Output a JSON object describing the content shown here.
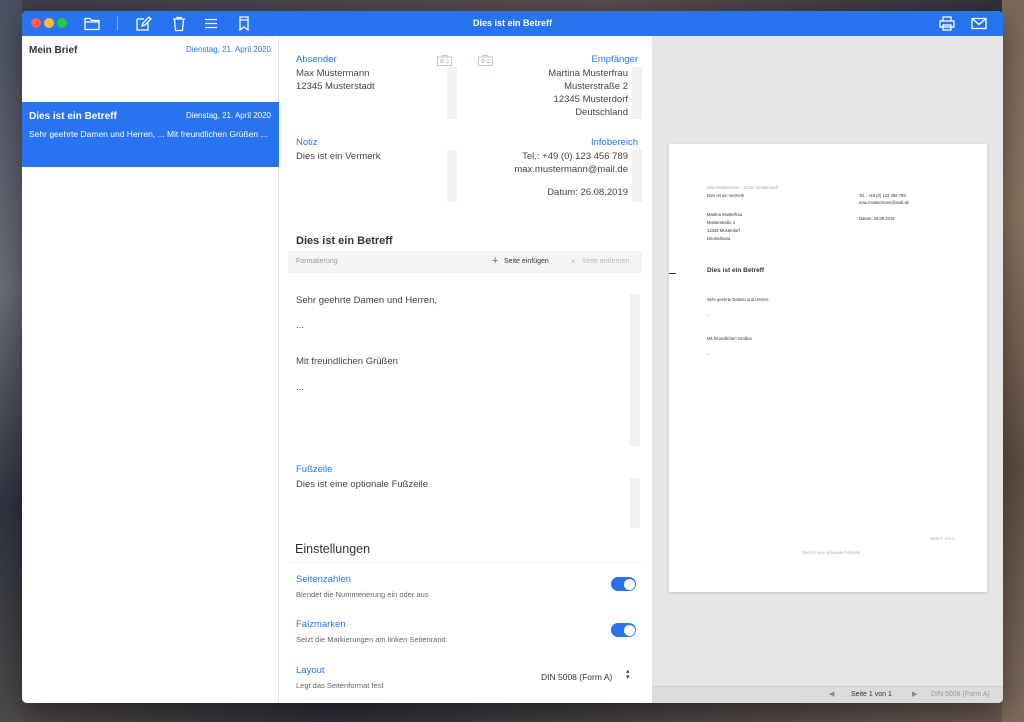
{
  "window": {
    "title": "Dies ist ein Betreff"
  },
  "toolbar": {
    "icons": [
      "folder-icon",
      "compose-icon",
      "trash-icon",
      "list-icon",
      "bookmark-icon",
      "print-icon",
      "mail-icon"
    ]
  },
  "sidebar": {
    "items": [
      {
        "title": "Mein Brief",
        "date": "Dienstag, 21. April 2020",
        "preview": ""
      },
      {
        "title": "Dies ist ein Betreff",
        "date": "Dienstag, 21. April 2020",
        "preview": "Sehr geehrte Damen und Herren,  ...   Mit freundlichen Grüßen  ..."
      }
    ]
  },
  "editor": {
    "sender": {
      "label": "Absender",
      "line1": "Max Mustermann",
      "line2": "12345 Musterstadt"
    },
    "recipient": {
      "label": "Empfänger",
      "line1": "Martina Musterfrau",
      "line2": "Musterstraße 2",
      "line3": "12345 Musterdorf",
      "line4": "Deutschland"
    },
    "note": {
      "label": "Notiz",
      "text": "Dies ist ein Vermerk"
    },
    "info": {
      "label": "Infobereich",
      "line1": "Tel.: +49 (0) 123 456 789",
      "line2": "max.mustermann@mail.de",
      "line3": "Datum: 26.08.2019"
    },
    "subject": "Dies ist ein Betreff",
    "format_bar": {
      "placeholder": "Formatierung",
      "insert_page": "Seite einfügen",
      "remove_page": "Seite entfernen"
    },
    "body": {
      "greeting": "Sehr geehrte Damen und Herren,",
      "ellipsis1": "...",
      "closing": "Mit freundlichen Grüßen",
      "ellipsis2": "..."
    },
    "footer": {
      "label": "Fußzeile",
      "text": "Dies ist eine optionale Fußzeile"
    },
    "settings": {
      "title": "Einstellungen",
      "page_numbers": {
        "label": "Seitenzahlen",
        "desc": "Blendet die Nummerierung ein oder aus",
        "on": true
      },
      "fold_marks": {
        "label": "Falzmarken",
        "desc": "Setzt die Markierungen am linken Seitenrand",
        "on": true
      },
      "layout": {
        "label": "Layout",
        "desc": "Legt das Seitenformat fest",
        "value": "DIN 5008 (Form A)"
      }
    }
  },
  "preview": {
    "sender_line": "Max Mustermann · 12345 Musterstadt",
    "note": "Dies ist ein Vermerk",
    "recipient": [
      "Martina Musterfrau",
      "Musterstraße 2",
      "12345 Musterdorf",
      "Deutschland"
    ],
    "info": [
      "Tel.: +49 (0) 123 456 789",
      "max.mustermann@mail.de"
    ],
    "date": "Datum: 26.08.2019",
    "subject": "Dies ist ein Betreff",
    "greeting": "Sehr geehrte Damen und Herren,",
    "ellipsis1": "...",
    "closing": "Mit freundlichen Grüßen",
    "ellipsis2": "...",
    "page_number": "Seite 1 von 1",
    "footer": "Dies ist eine optionale Fußzeile"
  },
  "status": {
    "page": "Seite 1 von 1",
    "format": "DIN 5008 (Form A)"
  }
}
